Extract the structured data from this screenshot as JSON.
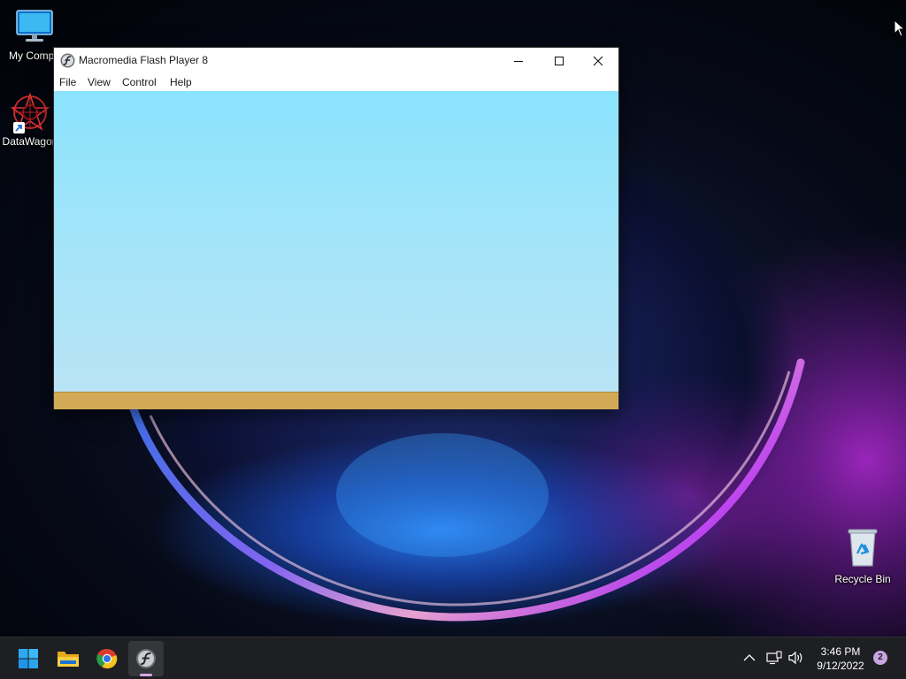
{
  "desktop": {
    "icons": [
      {
        "label": "My Compu",
        "icon": "monitor-icon"
      },
      {
        "label": "DataWagon",
        "icon": "datawagon-icon"
      },
      {
        "label": "Recycle Bin",
        "icon": "recycle-bin-icon"
      }
    ]
  },
  "window": {
    "title": "Macromedia Flash Player 8",
    "icon": "flash-player-icon",
    "menu": [
      "File",
      "View",
      "Control",
      "Help"
    ],
    "controls": [
      "minimize-icon",
      "maximize-icon",
      "close-icon"
    ],
    "stage_colors": {
      "sky_top": "#8ae3fc",
      "sky_bottom": "#b9e3f5",
      "ground": "#d2a956"
    }
  },
  "taskbar": {
    "apps": [
      {
        "name": "Start",
        "icon": "windows-start-icon"
      },
      {
        "name": "File Explorer",
        "icon": "folder-icon"
      },
      {
        "name": "Google Chrome",
        "icon": "chrome-icon"
      },
      {
        "name": "Macromedia Flash Player 8",
        "icon": "flash-player-icon",
        "active": true
      }
    ],
    "tray": {
      "icons": [
        "chevron-up-icon",
        "network-icon",
        "volume-icon"
      ],
      "time": "3:46 PM",
      "date": "9/12/2022",
      "notifications": "2"
    }
  }
}
